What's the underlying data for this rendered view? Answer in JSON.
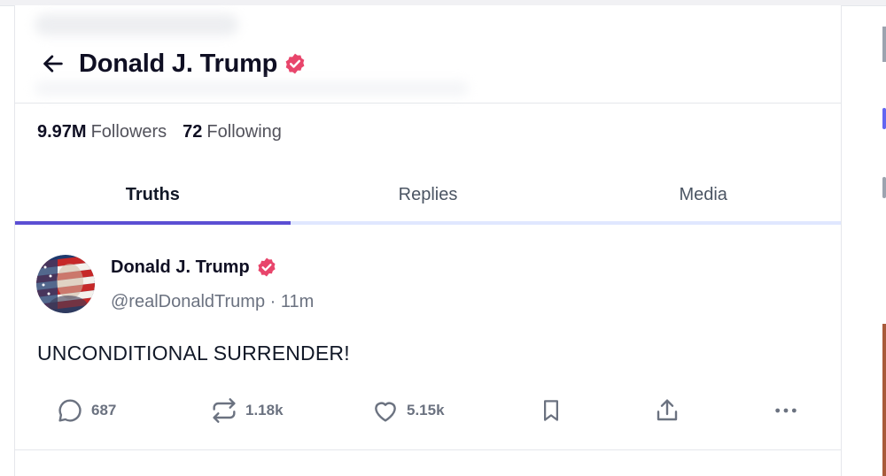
{
  "profile": {
    "name": "Donald J. Trump",
    "followers_count": "9.97M",
    "followers_label": "Followers",
    "following_count": "72",
    "following_label": "Following"
  },
  "tabs": [
    {
      "label": "Truths",
      "active": true
    },
    {
      "label": "Replies",
      "active": false
    },
    {
      "label": "Media",
      "active": false
    }
  ],
  "post": {
    "author": "Donald J. Trump",
    "handle_time": "@realDonaldTrump · 11m",
    "text": "UNCONDITIONAL SURRENDER!",
    "replies": "687",
    "retruths": "1.18k",
    "likes": "5.15k"
  },
  "icons": {
    "back": "arrow-left-icon",
    "verified": "verified-badge-icon",
    "reply": "comment-icon",
    "retruth": "repost-icon",
    "like": "heart-icon",
    "bookmark": "bookmark-icon",
    "share": "share-icon",
    "more": "more-icon"
  },
  "colors": {
    "accent": "#5b4fd3",
    "verified": "#e8456b",
    "tab_track": "#e0e7ff"
  }
}
